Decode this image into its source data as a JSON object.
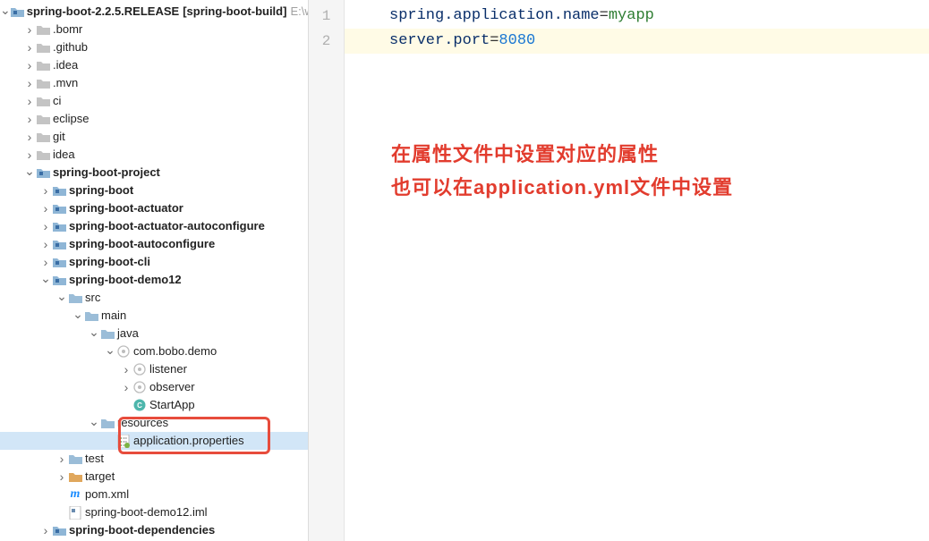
{
  "root": {
    "name": "spring-boot-2.2.5.RELEASE",
    "suffix": "[spring-boot-build]",
    "path_hint": "E:\\w"
  },
  "tree": {
    "items": [
      {
        "d": 0,
        "arrow": "down",
        "icon": "module",
        "label": "spring-boot-2.2.5.RELEASE",
        "bold": true,
        "suffix": "[spring-boot-build]",
        "hint": "E:\\w"
      },
      {
        "d": 1,
        "arrow": "right",
        "icon": "folder",
        "label": ".bomr"
      },
      {
        "d": 1,
        "arrow": "right",
        "icon": "folder",
        "label": ".github"
      },
      {
        "d": 1,
        "arrow": "right",
        "icon": "folder",
        "label": ".idea"
      },
      {
        "d": 1,
        "arrow": "right",
        "icon": "folder",
        "label": ".mvn"
      },
      {
        "d": 1,
        "arrow": "right",
        "icon": "folder",
        "label": "ci"
      },
      {
        "d": 1,
        "arrow": "right",
        "icon": "folder",
        "label": "eclipse"
      },
      {
        "d": 1,
        "arrow": "right",
        "icon": "folder",
        "label": "git"
      },
      {
        "d": 1,
        "arrow": "right",
        "icon": "folder",
        "label": "idea"
      },
      {
        "d": 1,
        "arrow": "down",
        "icon": "module",
        "label": "spring-boot-project",
        "bold": true
      },
      {
        "d": 2,
        "arrow": "right",
        "icon": "module",
        "label": "spring-boot",
        "bold": true
      },
      {
        "d": 2,
        "arrow": "right",
        "icon": "module",
        "label": "spring-boot-actuator",
        "bold": true
      },
      {
        "d": 2,
        "arrow": "right",
        "icon": "module",
        "label": "spring-boot-actuator-autoconfigure",
        "bold": true
      },
      {
        "d": 2,
        "arrow": "right",
        "icon": "module",
        "label": "spring-boot-autoconfigure",
        "bold": true
      },
      {
        "d": 2,
        "arrow": "right",
        "icon": "module",
        "label": "spring-boot-cli",
        "bold": true
      },
      {
        "d": 2,
        "arrow": "down",
        "icon": "module",
        "label": "spring-boot-demo12",
        "bold": true
      },
      {
        "d": 3,
        "arrow": "down",
        "icon": "src",
        "label": "src"
      },
      {
        "d": 4,
        "arrow": "down",
        "icon": "src",
        "label": "main"
      },
      {
        "d": 5,
        "arrow": "down",
        "icon": "src",
        "label": "java"
      },
      {
        "d": 6,
        "arrow": "down",
        "icon": "pkg",
        "label": "com.bobo.demo"
      },
      {
        "d": 7,
        "arrow": "right",
        "icon": "pkg",
        "label": "listener"
      },
      {
        "d": 7,
        "arrow": "right",
        "icon": "pkg",
        "label": "observer"
      },
      {
        "d": 7,
        "arrow": "none",
        "icon": "java",
        "label": "StartApp"
      },
      {
        "d": 5,
        "arrow": "down",
        "icon": "src",
        "label": "resources"
      },
      {
        "d": 6,
        "arrow": "none",
        "icon": "props",
        "label": "application.properties",
        "selected": true
      },
      {
        "d": 3,
        "arrow": "right",
        "icon": "src",
        "label": "test"
      },
      {
        "d": 3,
        "arrow": "right",
        "icon": "target",
        "label": "target"
      },
      {
        "d": 3,
        "arrow": "none",
        "icon": "pom",
        "label": "pom.xml"
      },
      {
        "d": 3,
        "arrow": "none",
        "icon": "iml",
        "label": "spring-boot-demo12.iml"
      },
      {
        "d": 2,
        "arrow": "right",
        "icon": "module",
        "label": "spring-boot-dependencies",
        "bold": true
      }
    ]
  },
  "editor": {
    "lines": [
      {
        "num": "1",
        "key": "spring.application.name",
        "eq": "=",
        "val": "myapp",
        "valtype": "str"
      },
      {
        "num": "2",
        "key": "server.port",
        "eq": "=",
        "val": "8080",
        "valtype": "num",
        "hl": true
      }
    ]
  },
  "annotation": {
    "line1": "在属性文件中设置对应的属性",
    "line2": "也可以在application.yml文件中设置"
  }
}
